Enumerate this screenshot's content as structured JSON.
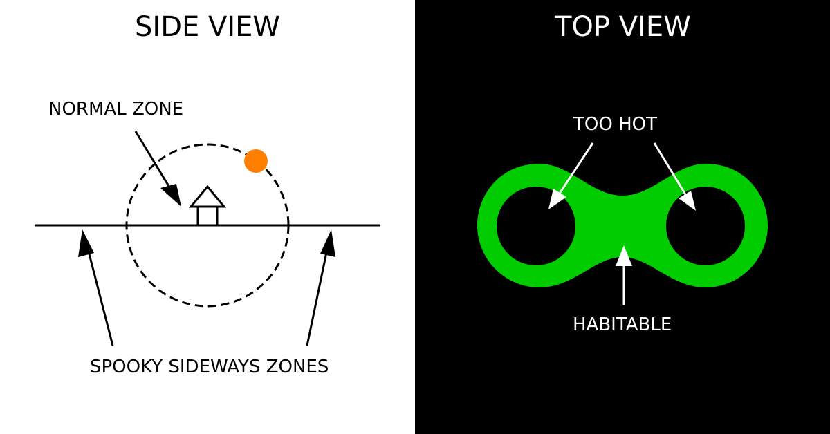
{
  "side_view": {
    "title": "SIDE VIEW",
    "normal_zone_label": "NORMAL ZONE",
    "spooky_label": "SPOOKY SIDEWAYS ZONES",
    "sun_color": "#ff8000"
  },
  "top_view": {
    "title": "TOP VIEW",
    "too_hot_label": "TOO HOT",
    "habitable_label": "HABITABLE",
    "habitable_color": "#00cc00"
  }
}
